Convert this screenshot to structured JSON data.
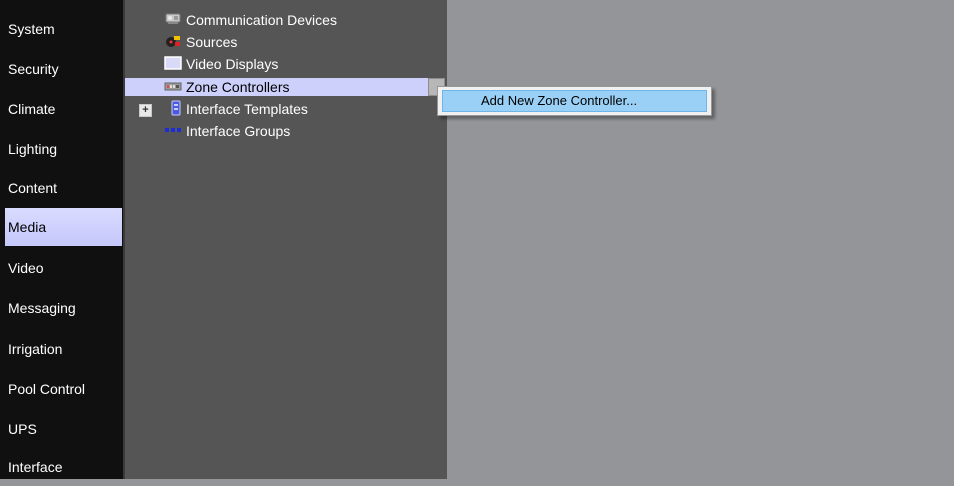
{
  "sidebar": {
    "items": [
      {
        "label": "System",
        "active": false
      },
      {
        "label": "Security",
        "active": false
      },
      {
        "label": "Climate",
        "active": false
      },
      {
        "label": "Lighting",
        "active": false
      },
      {
        "label": "Content",
        "active": false
      },
      {
        "label": "Media",
        "active": true
      },
      {
        "label": "Video",
        "active": false
      },
      {
        "label": "Messaging",
        "active": false
      },
      {
        "label": "Irrigation",
        "active": false
      },
      {
        "label": "Pool Control",
        "active": false
      },
      {
        "label": "UPS",
        "active": false
      },
      {
        "label": "Interface",
        "active": false
      }
    ]
  },
  "tree": {
    "items": [
      {
        "label": "Communication Devices",
        "icon": "communication-devices-icon"
      },
      {
        "label": "Sources",
        "icon": "sources-icon"
      },
      {
        "label": "Video Displays",
        "icon": "video-display-icon"
      },
      {
        "label": "Zone Controllers",
        "icon": "zone-controller-icon",
        "selected": true
      },
      {
        "label": "Interface Templates",
        "icon": "interface-template-icon",
        "expandable": true
      },
      {
        "label": "Interface Groups",
        "icon": "interface-groups-icon"
      }
    ]
  },
  "context_menu": {
    "items": [
      {
        "label": "Add New Zone Controller..."
      }
    ]
  },
  "colors": {
    "sidebar_bg": "#101010",
    "tree_bg": "#555555",
    "content_bg": "#939598",
    "selected_bg": "#ccd0fa",
    "menu_highlight": "#9ad0f5"
  }
}
